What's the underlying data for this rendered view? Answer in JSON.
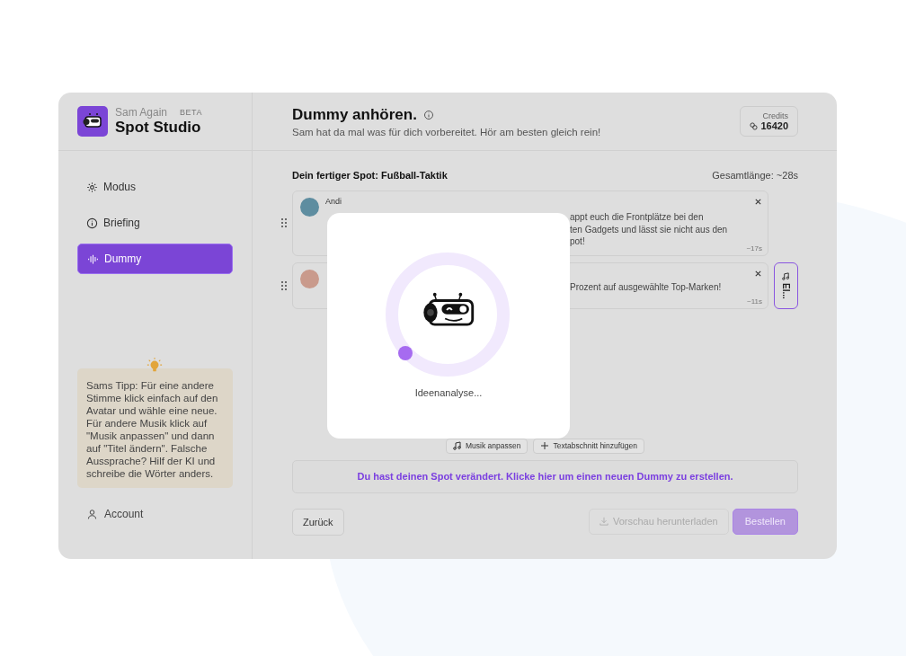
{
  "brand": {
    "product": "Sam Again",
    "badge": "BETA",
    "name": "Spot Studio"
  },
  "nav": [
    {
      "label": "Modus",
      "kind": "gear",
      "selected": false
    },
    {
      "label": "Briefing",
      "kind": "info",
      "selected": false
    },
    {
      "label": "Dummy",
      "kind": "wave",
      "selected": true
    }
  ],
  "tip": "Sams Tipp: Für eine andere Stimme klick einfach auf den Avatar und wähle eine neue. Für andere Musik klick auf \"Musik anpassen\" und dann auf \"Titel ändern\". Falsche Aussprache? Hilf der KI und schreibe die Wörter anders.",
  "account": "Account",
  "header": {
    "title": "Dummy anhören.",
    "subtitle": "Sam hat da mal was für dich vorbereitet. Hör am besten gleich rein!",
    "credits_label": "Credits",
    "credits": "16420"
  },
  "spot": {
    "title": "Dein fertiger Spot: Fußball-Taktik",
    "total": "Gesamtlänge: ~28s"
  },
  "segments": [
    {
      "speaker": "Andi",
      "lines": [
        "appt euch die Frontplätze bei den",
        "ten Gadgets und lässt sie nicht aus den",
        "pot!"
      ],
      "duration": "~17s"
    },
    {
      "lines": [
        "Prozent auf ausgewählte Top-Marken!"
      ],
      "duration": "~11s"
    }
  ],
  "side_button": "El...",
  "actions": [
    "Musik anpassen",
    "Textabschnitt hinzufügen"
  ],
  "notice": "Du hast deinen Spot verändert. Klicke hier um einen neuen Dummy zu erstellen.",
  "footer": {
    "back": "Zurück",
    "download": {
      "label": "Vorschau herunterladen",
      "disabled": true
    },
    "order": {
      "label": "Bestellen",
      "disabled": true
    }
  },
  "modal": {
    "status": "Ideenanalyse..."
  }
}
